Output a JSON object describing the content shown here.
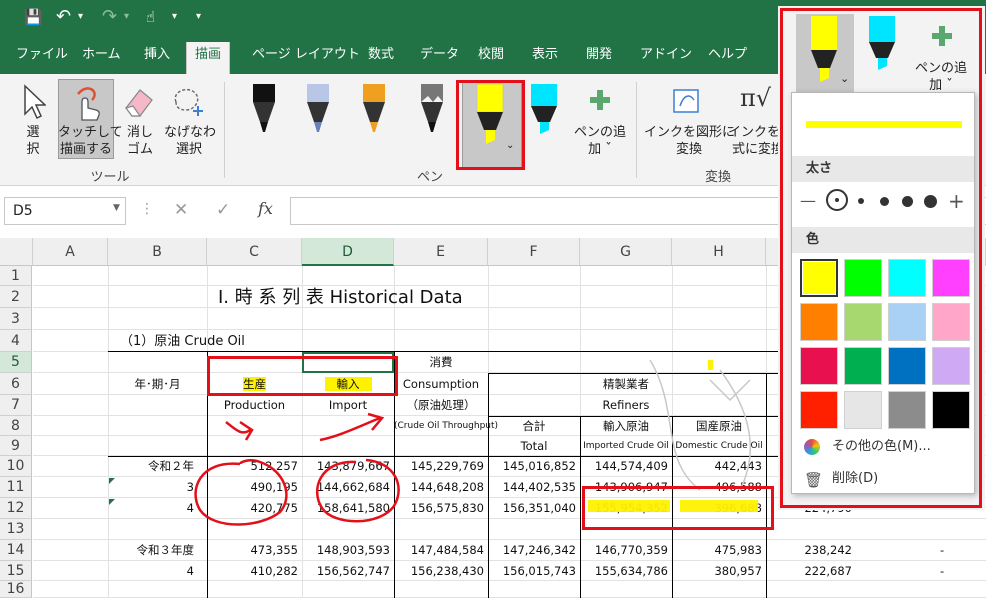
{
  "qat": {
    "save": "💾",
    "undo": "↶",
    "redo": "↷",
    "touch": "☝",
    "more": "▾"
  },
  "tabs": [
    "ファイル",
    "ホーム",
    "挿入",
    "描画",
    "ページ レイアウト",
    "数式",
    "データ",
    "校閲",
    "表示",
    "開発",
    "アドイン",
    "ヘルプ"
  ],
  "ribbon": {
    "tools": {
      "select": "選\n択",
      "touch_draw": "タッチして\n描画する",
      "eraser": "消し\nゴム",
      "lasso": "なげなわ\n選択",
      "group_label": "ツール"
    },
    "pens": {
      "add_pen": "ペンの追\n加 ˇ",
      "group_label": "ペン"
    },
    "convert": {
      "ink_to_shape": "インクを図形に\n変換",
      "ink_to_math": "インクを数\n式に変換",
      "group_label": "変換"
    }
  },
  "formula_bar": {
    "name_box": "D5",
    "fx": "fx",
    "cancel": "✕",
    "enter": "✓",
    "value": ""
  },
  "columns": [
    "A",
    "B",
    "C",
    "D",
    "E",
    "F",
    "G",
    "H"
  ],
  "rows": [
    "1",
    "2",
    "3",
    "4",
    "5",
    "6",
    "7",
    "8",
    "9",
    "10",
    "11",
    "12",
    "13",
    "14",
    "15",
    "16"
  ],
  "sheet": {
    "title": "Ⅰ. 時 系 列 表  Historical Data",
    "section": "（1）原油  Crude Oil",
    "h_consume": "消費",
    "h_period": "年･期･月",
    "h_prod_jp": "生産",
    "h_import_jp": "輸入",
    "h_consumption_en": "Consumption",
    "h_refiners_jp": "精製業者",
    "h_prod_en": "Production",
    "h_import_en": "Import",
    "h_crude_proc": "（原油処理）",
    "h_refiners_en": "Refiners",
    "h_throughput": "(Crude Oil Throughput)",
    "h_total_jp": "合計",
    "h_imported_jp": "輸入原油",
    "h_domestic_jp": "国産原油",
    "h_total_en": "Total",
    "h_imported_en": "Imported Crude Oil",
    "h_domestic_en": "Domestic Crude Oil",
    "rows": [
      {
        "label": "令和２年",
        "prod": "512,257",
        "import": "143,879,667",
        "cons": "145,229,769",
        "total": "145,016,852",
        "imp_crude": "144,574,409",
        "dom": "442,443",
        "extra": ""
      },
      {
        "label": "3",
        "prod": "490,195",
        "import": "144,662,684",
        "cons": "144,648,208",
        "total": "144,402,535",
        "imp_crude": "143,906,947",
        "dom": "496,588",
        "extra": ""
      },
      {
        "label": "4",
        "prod": "420,775",
        "import": "158,641,580",
        "cons": "156,575,830",
        "total": "156,351,040",
        "imp_crude": "155,954,352",
        "dom": "396,688",
        "extra": "224,790"
      },
      {
        "label": "令和３年度",
        "prod": "473,355",
        "import": "148,903,593",
        "cons": "147,484,584",
        "total": "147,246,342",
        "imp_crude": "146,770,359",
        "dom": "475,983",
        "extra": "238,242"
      },
      {
        "label": "4",
        "prod": "410,282",
        "import": "156,562,747",
        "cons": "156,238,430",
        "total": "156,015,743",
        "imp_crude": "155,634,786",
        "dom": "380,957",
        "extra": "222,687"
      }
    ],
    "dash": "-"
  },
  "popup": {
    "add_pen": "ペンの追\n加 ˇ",
    "thickness_label": "太さ",
    "color_label": "色",
    "more_colors": "その他の色(M)...",
    "delete": "削除(D)"
  },
  "colors": {
    "excel_green": "#217346",
    "highlight": "#fff200",
    "annot_red": "#e3101a",
    "swatches": [
      "#ffff00",
      "#00ff00",
      "#00ffff",
      "#ff40ff",
      "#ff8000",
      "#a6d86f",
      "#a9d0f5",
      "#ffa6c9",
      "#e8104e",
      "#00b050",
      "#0070c0",
      "#d0a9f5",
      "#ff2000",
      "#e6e6e6",
      "#8c8c8c",
      "#000000"
    ]
  }
}
